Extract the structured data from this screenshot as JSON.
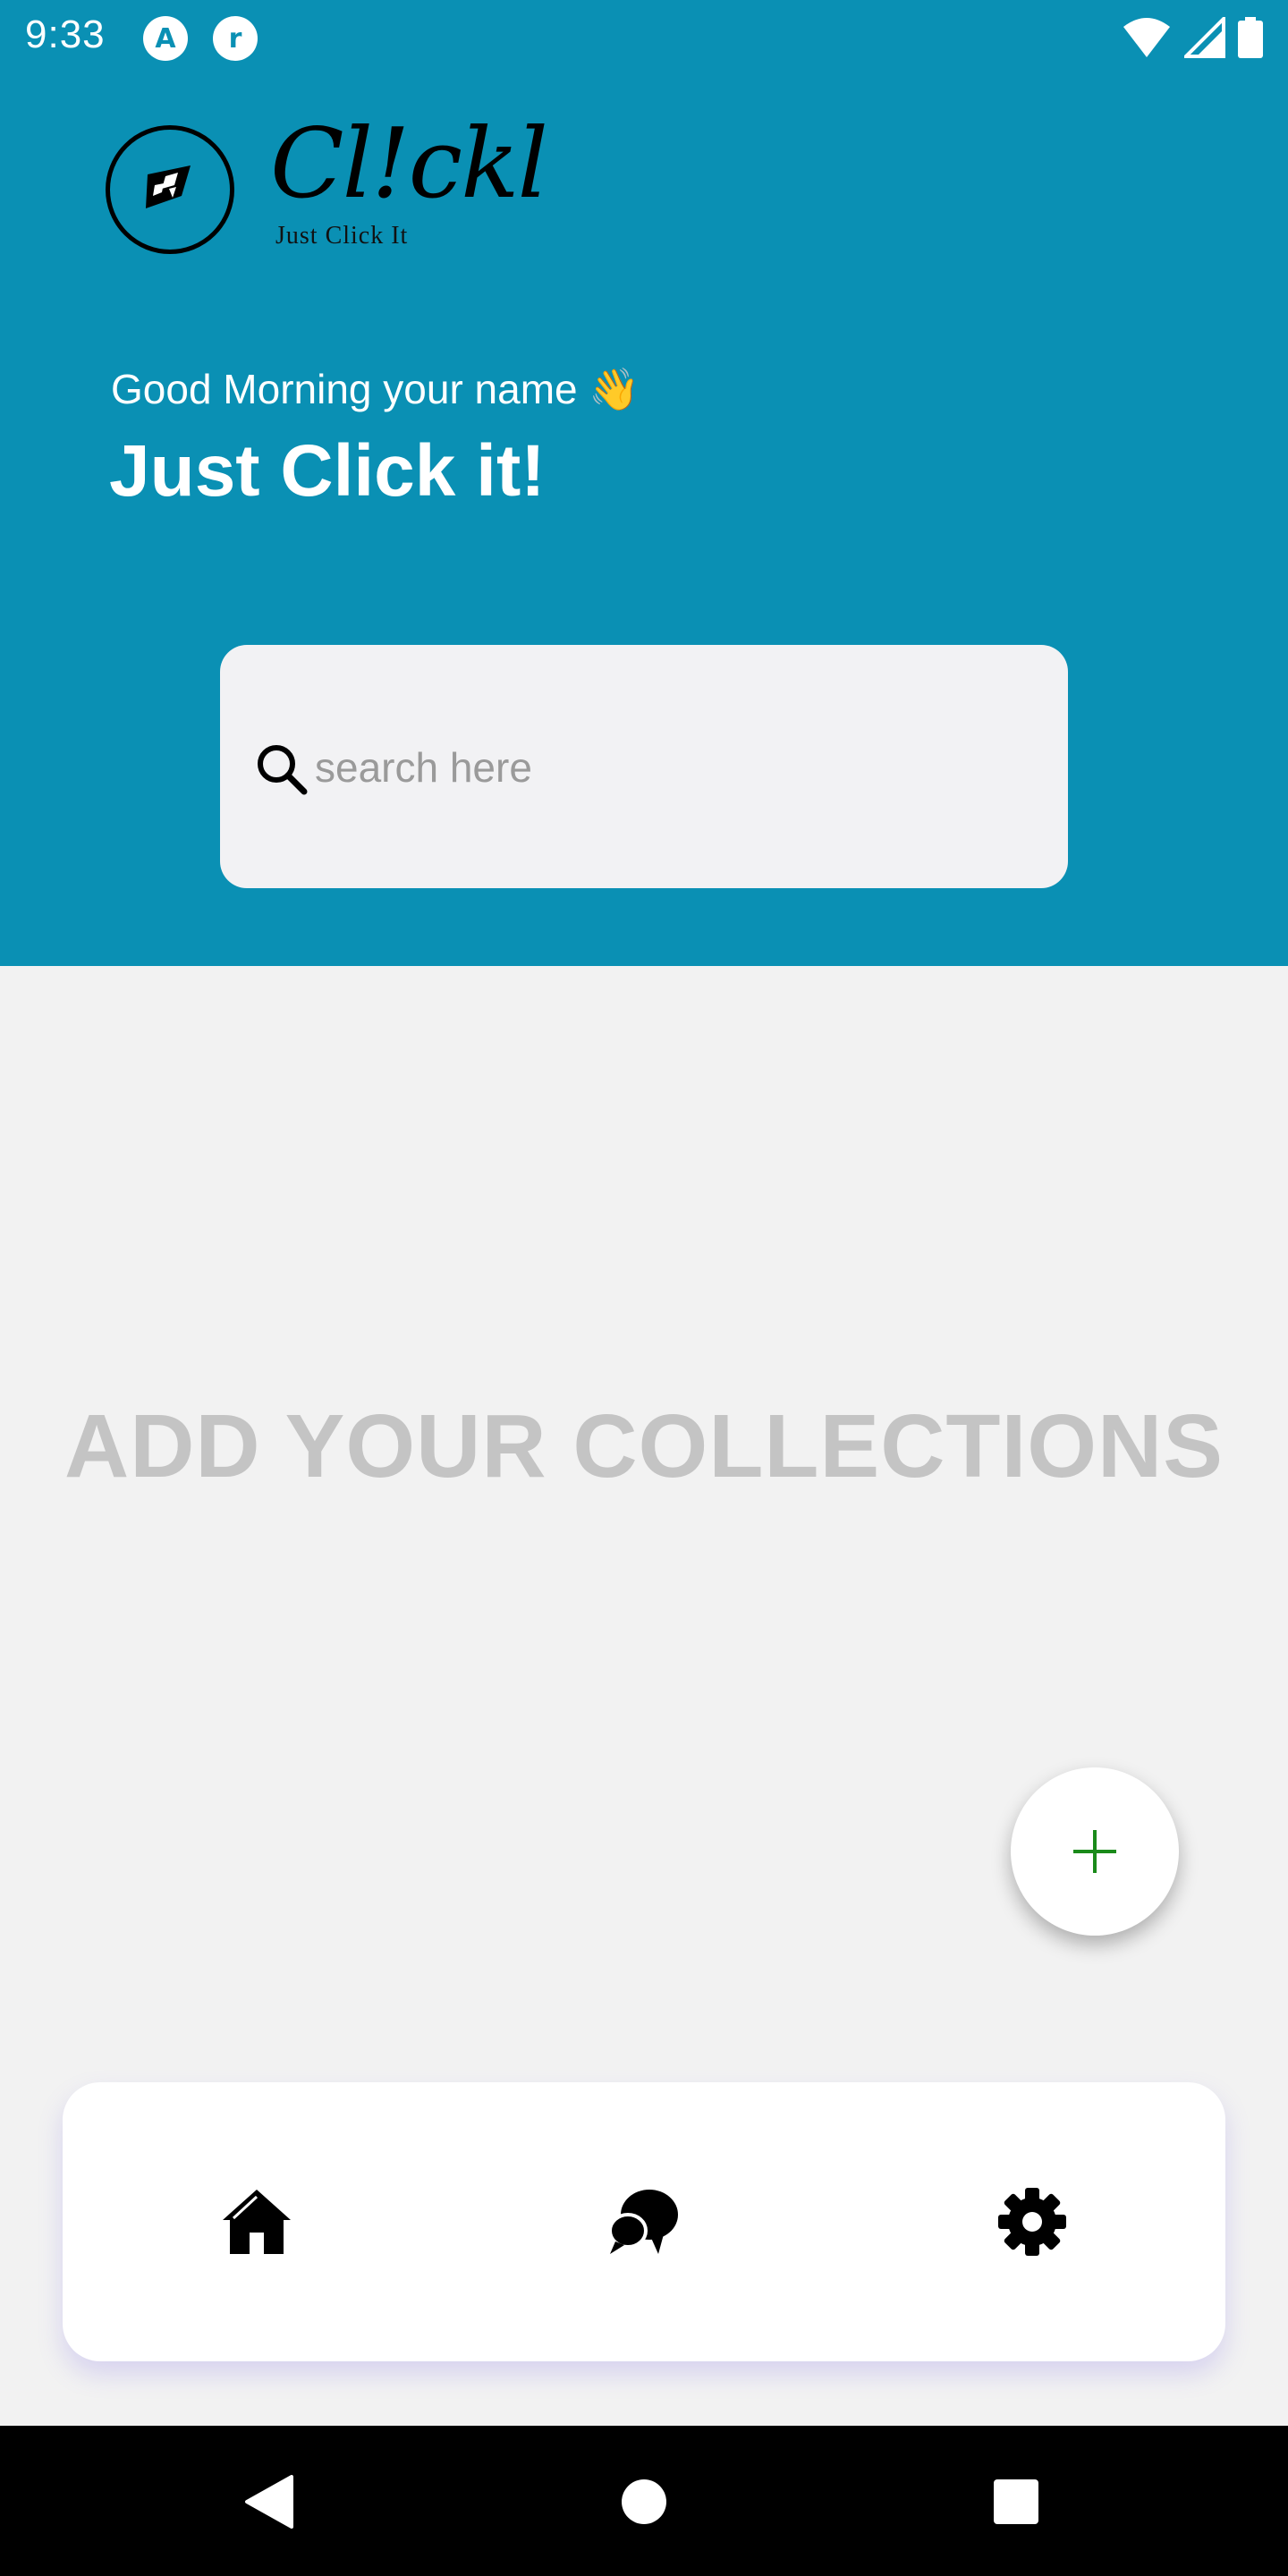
{
  "status_bar": {
    "time": "9:33",
    "app_icon_1": "A",
    "app_icon_2": "r"
  },
  "brand": {
    "name": "Cl!ckl",
    "tagline": "Just Click It"
  },
  "greeting": "Good Morning your name 👋",
  "headline": "Just Click it!",
  "search": {
    "placeholder": "search here",
    "value": ""
  },
  "empty_state": "ADD YOUR COLLECTIONS",
  "fab_icon": "plus-icon",
  "bottom_nav": {
    "items": [
      {
        "icon": "home-icon",
        "active": true
      },
      {
        "icon": "chat-icon",
        "active": false
      },
      {
        "icon": "gear-icon",
        "active": false
      }
    ]
  },
  "system_nav": [
    "back",
    "home",
    "recents"
  ],
  "colors": {
    "header_bg": "#0a90b4",
    "page_bg": "#f2f2f2",
    "search_bg": "#f2f2f4",
    "fab_plus": "#1a8a1a",
    "empty_text": "#c4c4c4"
  }
}
